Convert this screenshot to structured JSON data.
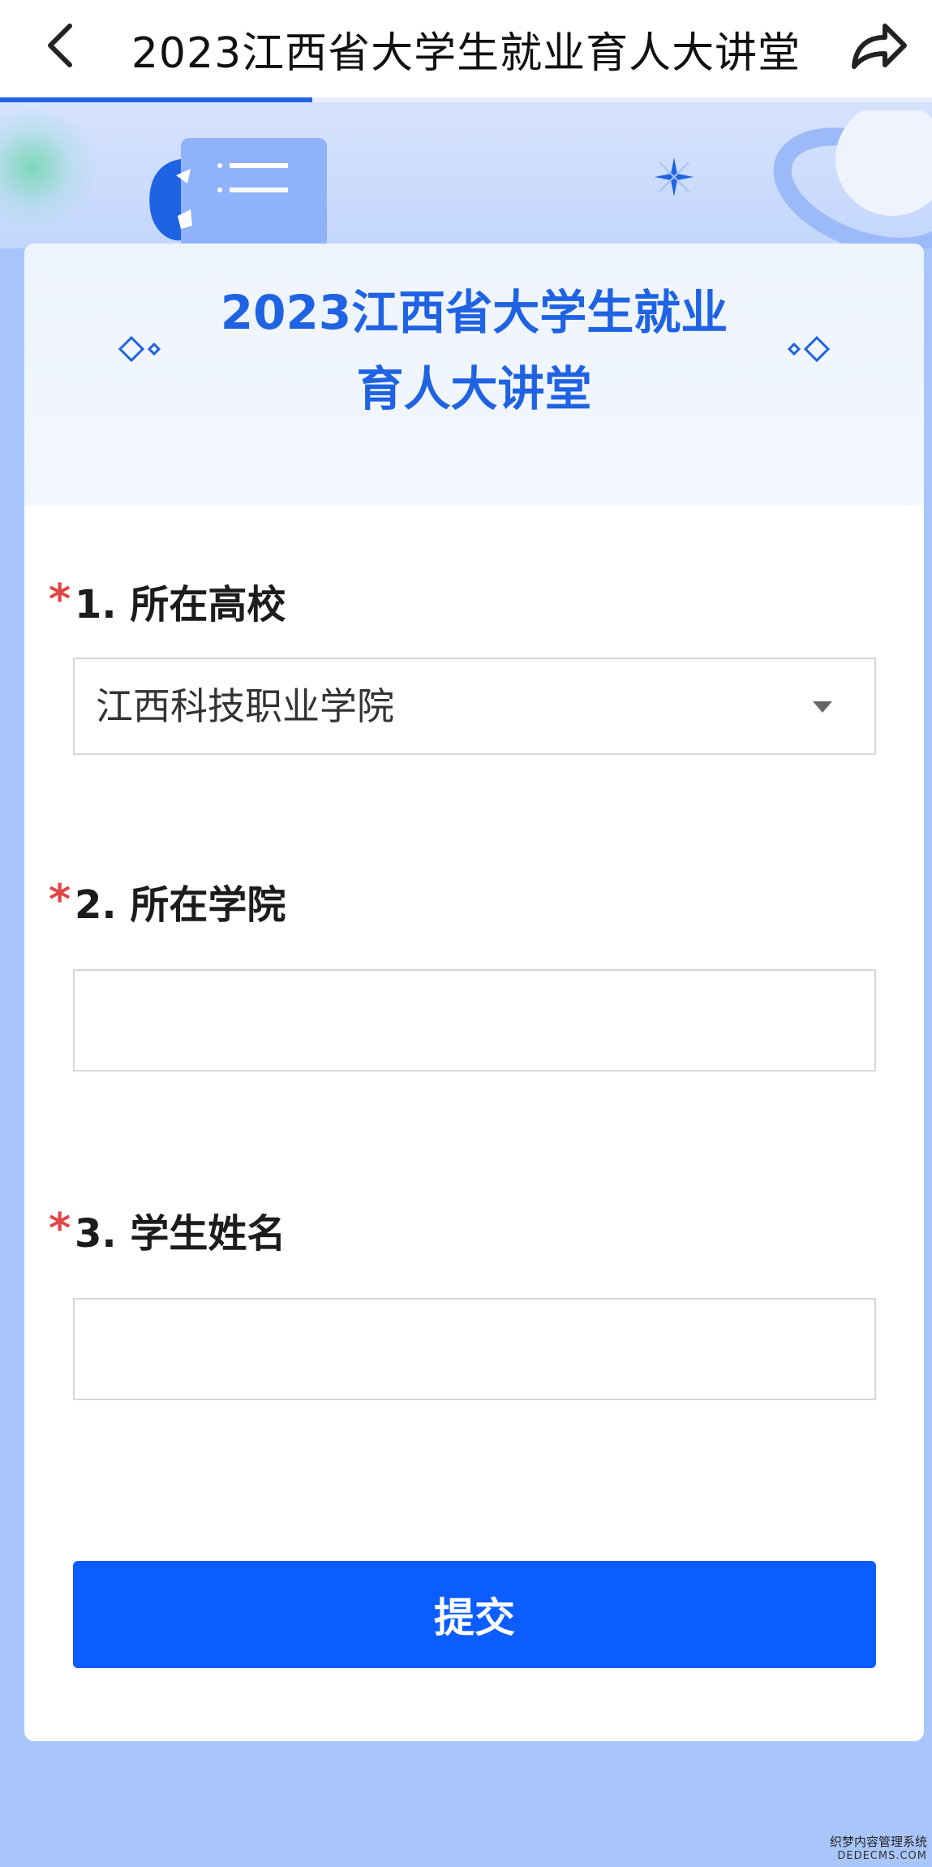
{
  "navbar": {
    "title": "2023江西省大学生就业育人大讲堂",
    "back_icon": "chevron-left-icon",
    "share_icon": "share-arrow-icon",
    "progress_fraction": 0.335
  },
  "header": {
    "title_line1": "2023江西省大学生就业",
    "title_line2": "育人大讲堂"
  },
  "form": {
    "required_mark": "*",
    "questions": [
      {
        "label": "1. 所在高校",
        "type": "select",
        "value": "江西科技职业学院"
      },
      {
        "label": "2. 所在学院",
        "type": "text",
        "value": ""
      },
      {
        "label": "3. 学生姓名",
        "type": "text",
        "value": ""
      }
    ],
    "submit_label": "提交"
  },
  "colors": {
    "accent": "#1f63e3",
    "button": "#0c5dff",
    "required": "#e14646",
    "page_background": "#a9c6fb"
  },
  "watermark": {
    "line1": "织梦内容管理系统",
    "line2": "DEDECMS.COM"
  }
}
